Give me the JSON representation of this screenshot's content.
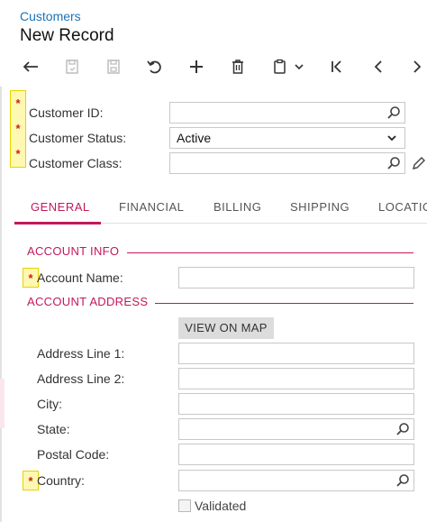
{
  "header": {
    "breadcrumb": "Customers",
    "title": "New Record"
  },
  "toolbar": {
    "buttons": [
      "back-icon",
      "save-close-icon",
      "save-icon",
      "undo-icon",
      "add-icon",
      "delete-icon",
      "copy-paste-icon",
      "first-record-icon",
      "previous-record-icon",
      "next-record-icon"
    ]
  },
  "summary": {
    "customer_id_label": "Customer ID:",
    "customer_id_value": "",
    "customer_status_label": "Customer Status:",
    "customer_status_value": "Active",
    "customer_class_label": "Customer Class:",
    "customer_class_value": "",
    "required_mark": "*"
  },
  "tabs": [
    {
      "label": "GENERAL",
      "active": true
    },
    {
      "label": "FINANCIAL",
      "active": false
    },
    {
      "label": "BILLING",
      "active": false
    },
    {
      "label": "SHIPPING",
      "active": false
    },
    {
      "label": "LOCATIO",
      "active": false
    }
  ],
  "account_info": {
    "section_title": "ACCOUNT INFO",
    "account_name_label": "Account Name:",
    "account_name_value": ""
  },
  "account_address": {
    "section_title": "ACCOUNT ADDRESS",
    "view_on_map_label": "VIEW ON MAP",
    "address_line_1_label": "Address Line 1:",
    "address_line_2_label": "Address Line 2:",
    "city_label": "City:",
    "state_label": "State:",
    "postal_code_label": "Postal Code:",
    "country_label": "Country:",
    "validated_label": "Validated"
  },
  "colors": {
    "accent": "#c2185b",
    "link": "#1a73b8",
    "required_highlight": "#fff8b0"
  }
}
